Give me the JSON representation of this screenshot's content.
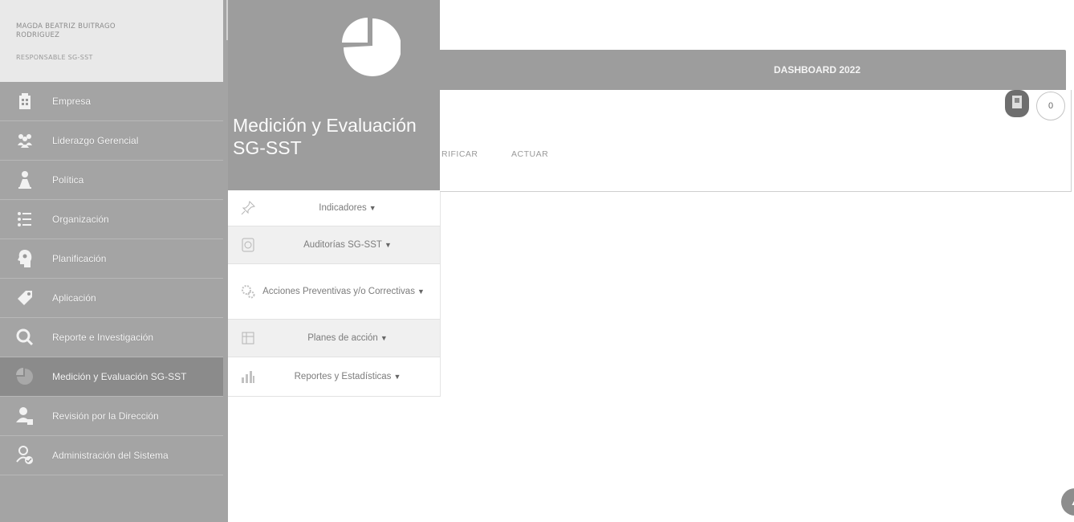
{
  "user": {
    "name": "MAGDA BEATRIZ BUITRAGO RODRIGUEZ",
    "role": "RESPONSABLE SG-SST"
  },
  "sidebar": {
    "items": [
      {
        "label": "Empresa",
        "icon": "building-icon"
      },
      {
        "label": "Liderazgo Gerencial",
        "icon": "team-icon"
      },
      {
        "label": "Política",
        "icon": "person-icon"
      },
      {
        "label": "Organización",
        "icon": "list-icon"
      },
      {
        "label": "Planificación",
        "icon": "head-icon"
      },
      {
        "label": "Aplicación",
        "icon": "tag-icon"
      },
      {
        "label": "Reporte e Investigación",
        "icon": "magnifier-icon"
      },
      {
        "label": "Medición y Evaluación SG-SST",
        "icon": "pie-chart-icon"
      },
      {
        "label": "Revisión por la Dirección",
        "icon": "manager-icon"
      },
      {
        "label": "Administración del Sistema",
        "icon": "admin-user-icon"
      }
    ],
    "active_index": 7
  },
  "section": {
    "title": "Medición y Evaluación SG-SST",
    "submenu": [
      {
        "label": "Indicadores",
        "icon": "pin-icon"
      },
      {
        "label": "Auditorías SG-SST",
        "icon": "audit-icon"
      },
      {
        "label": "Acciones Preventivas y/o Correctivas",
        "icon": "gears-icon"
      },
      {
        "label": "Planes de acción",
        "icon": "plan-icon"
      },
      {
        "label": "Reportes y Estadísticas",
        "icon": "bar-chart-icon"
      }
    ]
  },
  "dashboard": {
    "title": "DASHBOARD 2022",
    "tabs": [
      "RIFICAR",
      "ACTUAR"
    ],
    "circle_button_label": "0"
  },
  "colors": {
    "sidebar_bg": "#a4a4a4",
    "header_bg": "#9d9d9d",
    "active_item": "#8b8b8b"
  }
}
